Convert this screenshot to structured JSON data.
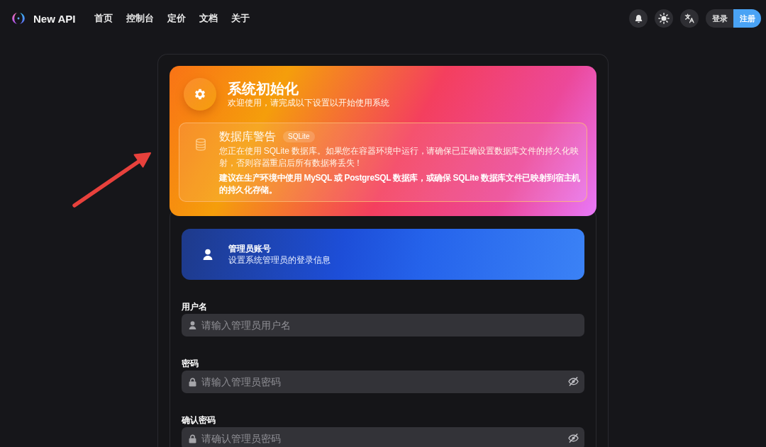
{
  "header": {
    "brand": "New API",
    "nav": [
      {
        "label": "首页",
        "selected": false
      },
      {
        "label": "控制台",
        "selected": false
      },
      {
        "label": "定价",
        "selected": false
      },
      {
        "label": "文档",
        "selected": false
      },
      {
        "label": "关于",
        "selected": false
      }
    ],
    "auth_buttons": [
      {
        "label": "登录",
        "kind": "secondary"
      },
      {
        "label": "注册",
        "kind": "primary"
      }
    ]
  },
  "setup": {
    "title": "系统初始化",
    "subtitle": "欢迎使用，请完成以下设置以开始使用系统",
    "warning": {
      "title": "数据库警告",
      "tag": "SQLite",
      "message": "您正在使用 SQLite 数据库。如果您在容器环境中运行，请确保已正确设置数据库文件的持久化映射，否则容器重启后所有数据将丢失！",
      "advice": "建议在生产环境中使用 MySQL 或 PostgreSQL 数据库，或确保 SQLite 数据库文件已映射到宿主机的持久化存储。"
    }
  },
  "admin_section": {
    "title": "管理员账号",
    "subtitle": "设置系统管理员的登录信息",
    "fields": [
      {
        "label": "用户名",
        "placeholder": "请输入管理员用户名",
        "kind": "text"
      },
      {
        "label": "密码",
        "placeholder": "请输入管理员密码",
        "kind": "password"
      },
      {
        "label": "确认密码",
        "placeholder": "请确认管理员密码",
        "kind": "password"
      }
    ]
  },
  "overlay_marks": [
    {
      "kind": "arrow"
    }
  ]
}
